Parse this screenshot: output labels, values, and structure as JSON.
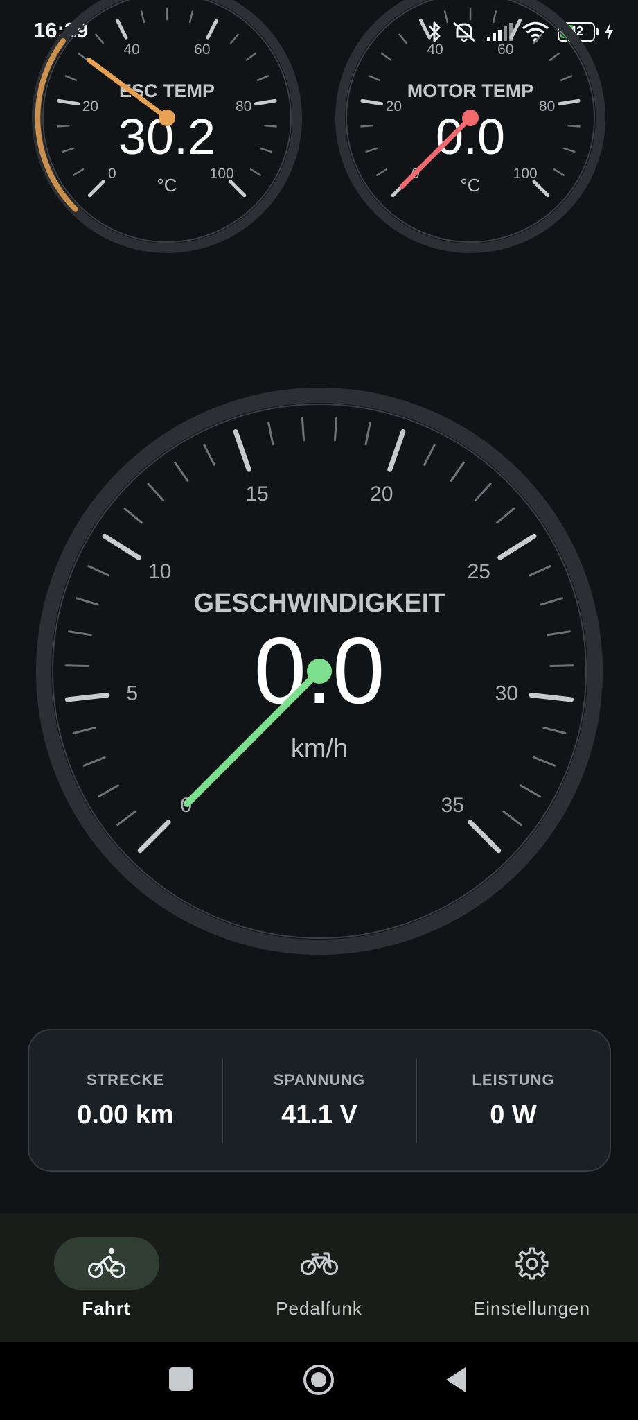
{
  "status_bar": {
    "time": "16:29",
    "battery_level": "42"
  },
  "gauges": {
    "esc_temp": {
      "title": "ESC TEMP",
      "value": "30.2",
      "unit": "°C",
      "ticks": [
        "0",
        "20",
        "40",
        "60",
        "80",
        "100"
      ],
      "min": 0,
      "max": 100,
      "reading": 30.2,
      "color": "#e8a150"
    },
    "motor_temp": {
      "title": "MOTOR TEMP",
      "value": "0.0",
      "unit": "°C",
      "ticks": [
        "0",
        "20",
        "40",
        "60",
        "80",
        "100"
      ],
      "min": 0,
      "max": 100,
      "reading": 0.0,
      "color": "#f26a6e"
    },
    "speed": {
      "title": "GESCHWINDIGKEIT",
      "value": "0.0",
      "unit": "km/h",
      "ticks": [
        "0",
        "5",
        "10",
        "15",
        "20",
        "25",
        "30",
        "35"
      ],
      "min": 0,
      "max": 35,
      "reading": 0.0,
      "color": "#7de08e"
    }
  },
  "stats": [
    {
      "label": "STRECKE",
      "value": "0.00 km"
    },
    {
      "label": "SPANNUNG",
      "value": "41.1 V"
    },
    {
      "label": "LEISTUNG",
      "value": "0 W"
    }
  ],
  "nav": {
    "items": [
      {
        "label": "Fahrt",
        "icon": "cyclist-icon",
        "active": true
      },
      {
        "label": "Pedalfunk",
        "icon": "bicycle-icon",
        "active": false
      },
      {
        "label": "Einstellungen",
        "icon": "gear-icon",
        "active": false
      }
    ]
  },
  "colors": {
    "background": "#101417",
    "gauge_ring": "#2c3034",
    "tick": "#c8cbce",
    "accent_nav": "#2f3d33"
  }
}
